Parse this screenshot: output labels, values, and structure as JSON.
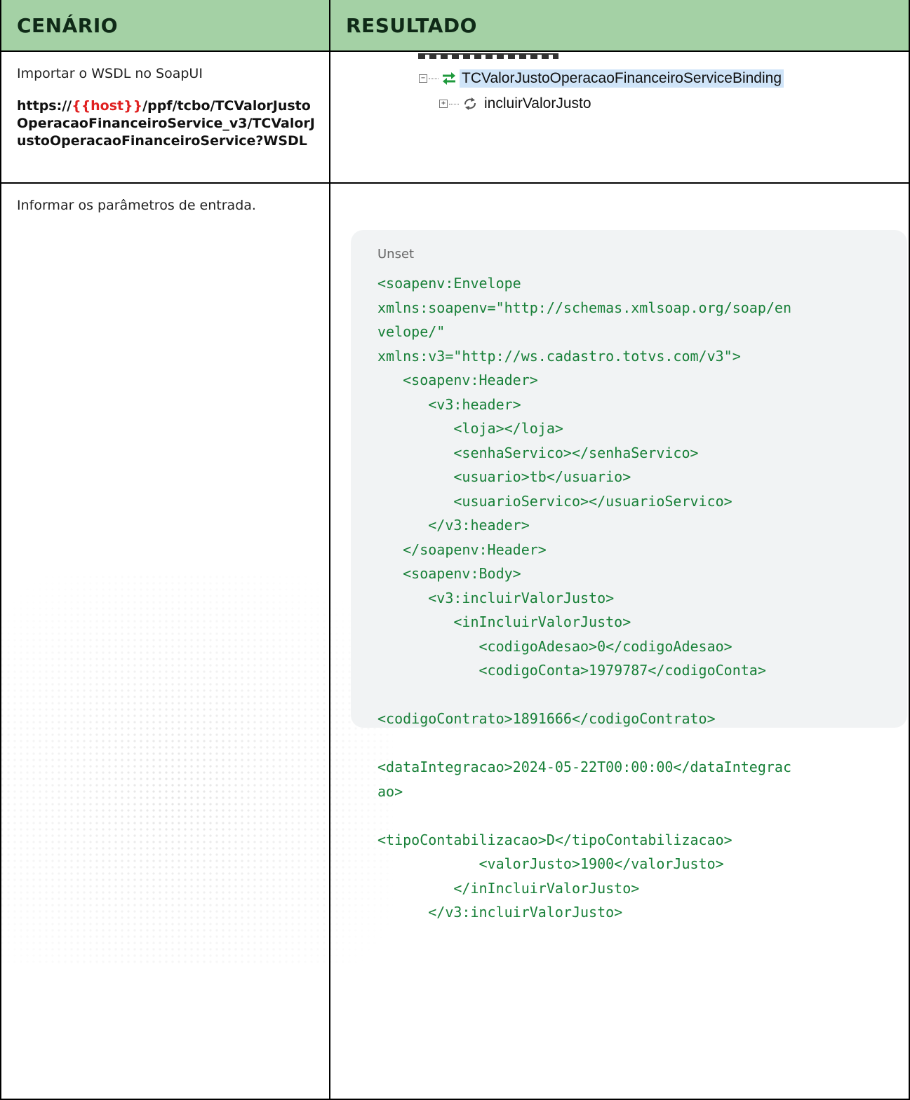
{
  "table": {
    "headers": {
      "scenario": "CENÁRIO",
      "result": "RESULTADO"
    },
    "row1": {
      "scenario_text": "Importar o WSDL no SoapUI",
      "url_prefix": "https://",
      "url_host": "{{host}}",
      "url_suffix": "/ppf/tcbo/TCValorJustoOperacaoFinanceiroService_v3/TCValorJustoOperacaoFinanceiroService?WSDL",
      "tree": {
        "binding_label": "TCValorJustoOperacaoFinanceiroServiceBinding",
        "operation_label": "incluirValorJusto",
        "binding_icon": "swap-arrows-icon",
        "operation_icon": "cycle-arrows-icon"
      }
    },
    "row2": {
      "scenario_text": "Informar os parâmetros de entrada.",
      "code_language": "Unset",
      "code_lines": [
        "<soapenv:Envelope",
        "xmlns:soapenv=\"http://schemas.xmlsoap.org/soap/en",
        "velope/\"",
        "xmlns:v3=\"http://ws.cadastro.totvs.com/v3\">",
        "   <soapenv:Header>",
        "      <v3:header>",
        "         <loja></loja>",
        "         <senhaServico></senhaServico>",
        "         <usuario>tb</usuario>",
        "         <usuarioServico></usuarioServico>",
        "      </v3:header>",
        "   </soapenv:Header>",
        "   <soapenv:Body>",
        "      <v3:incluirValorJusto>",
        "         <inIncluirValorJusto>",
        "            <codigoAdesao>0</codigoAdesao>",
        "            <codigoConta>1979787</codigoConta>",
        "",
        "<codigoContrato>1891666</codigoContrato>",
        "",
        "<dataIntegracao>2024-05-22T00:00:00</dataIntegrac",
        "ao>",
        "",
        "<tipoContabilizacao>D</tipoContabilizacao>",
        "            <valorJusto>1900</valorJusto>",
        "         </inIncluirValorJusto>",
        "      </v3:incluirValorJusto>"
      ]
    }
  },
  "colors": {
    "header_bg": "#a4d1a5",
    "host_red": "#e02020",
    "code_green": "#188038",
    "code_bg": "#f1f3f4",
    "selection_blue": "#cfe4f8"
  }
}
